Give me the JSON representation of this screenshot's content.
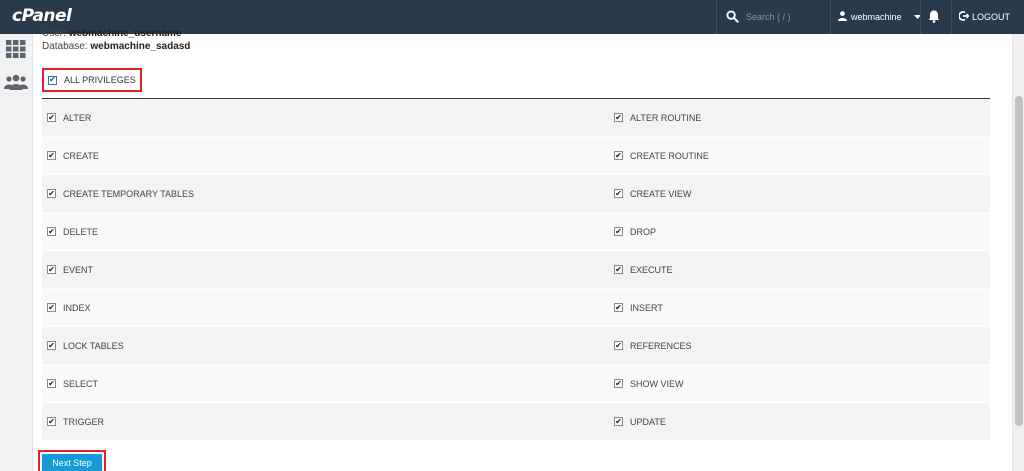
{
  "topbar": {
    "logo": "cPanel",
    "search_placeholder": "Search ( / )",
    "username": "webmachine",
    "logout": "LOGOUT"
  },
  "info": {
    "user_label": "User:",
    "user_value": "webmachine_username",
    "db_label": "Database:",
    "db_value": "webmachine_sadasd"
  },
  "all_privileges": {
    "label": "ALL PRIVILEGES",
    "checked": true
  },
  "privileges": [
    [
      "ALTER",
      "ALTER ROUTINE"
    ],
    [
      "CREATE",
      "CREATE ROUTINE"
    ],
    [
      "CREATE TEMPORARY TABLES",
      "CREATE VIEW"
    ],
    [
      "DELETE",
      "DROP"
    ],
    [
      "EVENT",
      "EXECUTE"
    ],
    [
      "INDEX",
      "INSERT"
    ],
    [
      "LOCK TABLES",
      "REFERENCES"
    ],
    [
      "SELECT",
      "SHOW VIEW"
    ],
    [
      "TRIGGER",
      "UPDATE"
    ]
  ],
  "next_button": "Next Step",
  "colors": {
    "topbar": "#293a4a",
    "button": "#179bd7",
    "highlight": "#e02428"
  }
}
